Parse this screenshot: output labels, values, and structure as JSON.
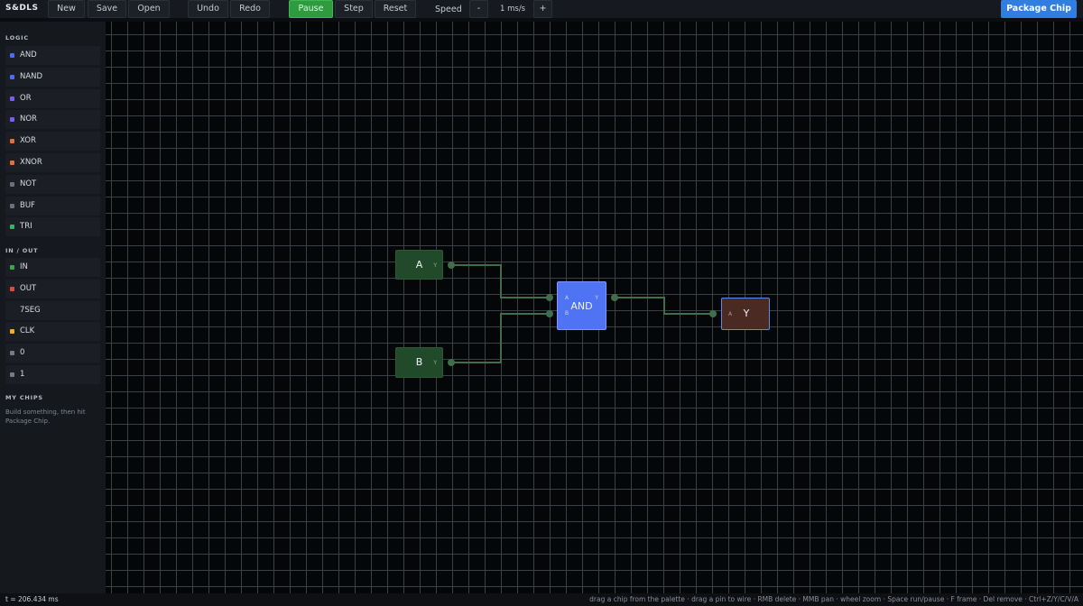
{
  "app": {
    "brand": "S&DLS"
  },
  "toolbar": {
    "new_label": "New",
    "save_label": "Save",
    "open_label": "Open",
    "undo_label": "Undo",
    "redo_label": "Redo",
    "pause_label": "Pause",
    "step_label": "Step",
    "reset_label": "Reset",
    "speed_label": "Speed",
    "speed_minus": "-",
    "speed_value": "1 ms/s",
    "speed_plus": "+",
    "package_label": "Package Chip",
    "pause_color": "#2e9b3f",
    "package_color": "#2f7ee0"
  },
  "sidebar": {
    "logic_header": "LOGIC",
    "logic_items": [
      {
        "label": "AND",
        "color": "#4a6cf0"
      },
      {
        "label": "NAND",
        "color": "#4a6cf0"
      },
      {
        "label": "OR",
        "color": "#7b5cf0"
      },
      {
        "label": "NOR",
        "color": "#7b5cf0"
      },
      {
        "label": "XOR",
        "color": "#e0703a"
      },
      {
        "label": "XNOR",
        "color": "#e0703a"
      },
      {
        "label": "NOT",
        "color": "#6b6f78"
      },
      {
        "label": "BUF",
        "color": "#6b6f78"
      },
      {
        "label": "TRI",
        "color": "#2fb56a"
      }
    ],
    "io_header": "IN / OUT",
    "io_items": [
      {
        "label": "IN",
        "color": "#3aa84a"
      },
      {
        "label": "OUT",
        "color": "#e04a3a"
      },
      {
        "label": "7SEG",
        "color": ""
      },
      {
        "label": "CLK",
        "color": "#f0b020"
      },
      {
        "label": "0",
        "color": "#777b83"
      },
      {
        "label": "1",
        "color": "#777b83"
      }
    ],
    "chips_header": "MY CHIPS",
    "chips_hint": "Build something, then hit Package Chip."
  },
  "canvas": {
    "nodes": {
      "input_a": {
        "label": "A",
        "pin": "Y",
        "color": "#214a2a"
      },
      "input_b": {
        "label": "B",
        "pin": "Y",
        "color": "#214a2a"
      },
      "gate_and": {
        "label": "AND",
        "in_pins": [
          "A",
          "B"
        ],
        "out_pin": "Y",
        "color": "#4f73f2"
      },
      "output_y": {
        "label": "Y",
        "pin": "A",
        "color": "#4a2a23",
        "border": "#4f90e8"
      }
    },
    "wire_color": "#3f6e4c"
  },
  "status": {
    "time": "t = 206.434 ms",
    "help": "drag a chip from the palette · drag a pin to wire · RMB delete · MMB pan · wheel zoom · Space run/pause · F frame · Del remove · Ctrl+Z/Y/C/V/A"
  }
}
